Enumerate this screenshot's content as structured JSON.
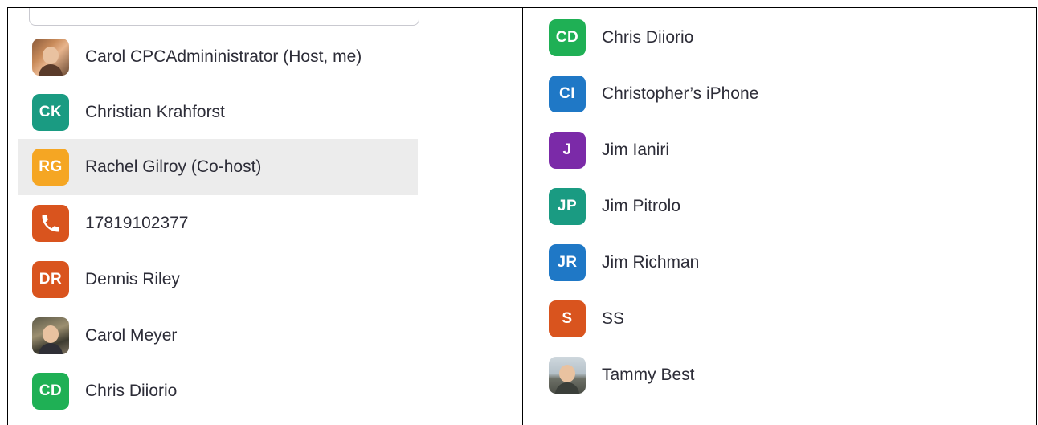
{
  "left_list": [
    {
      "name": "Carol CPCAdmininistrator (Host, me)",
      "avatar": "photo",
      "photo": "photo-a"
    },
    {
      "name": "Christian Krahforst",
      "avatar": "initials",
      "initials": "CK",
      "color": "#1a9b82"
    },
    {
      "name": "Rachel Gilroy (Co-host)",
      "avatar": "initials",
      "initials": "RG",
      "color": "#f5a623",
      "selected": true
    },
    {
      "name": "17819102377",
      "avatar": "icon",
      "icon": "phone-icon",
      "color": "#d9541e"
    },
    {
      "name": "Dennis Riley",
      "avatar": "initials",
      "initials": "DR",
      "color": "#d9541e"
    },
    {
      "name": "Carol Meyer",
      "avatar": "photo",
      "photo": "photo-b"
    },
    {
      "name": "Chris Diiorio",
      "avatar": "initials",
      "initials": "CD",
      "color": "#1fb055"
    }
  ],
  "right_list": [
    {
      "name": "Chris Diiorio",
      "avatar": "initials",
      "initials": "CD",
      "color": "#1fb055"
    },
    {
      "name": "Christopher’s iPhone",
      "avatar": "initials",
      "initials": "CI",
      "color": "#1f78c6"
    },
    {
      "name": "Jim Ianiri",
      "avatar": "initials",
      "initials": "J",
      "color": "#7b2aa8"
    },
    {
      "name": "Jim Pitrolo",
      "avatar": "initials",
      "initials": "JP",
      "color": "#1a9b82"
    },
    {
      "name": "Jim Richman",
      "avatar": "initials",
      "initials": "JR",
      "color": "#1f78c6"
    },
    {
      "name": "SS",
      "avatar": "initials",
      "initials": "S",
      "color": "#d9541e"
    },
    {
      "name": "Tammy Best",
      "avatar": "photo",
      "photo": "photo-c"
    }
  ]
}
